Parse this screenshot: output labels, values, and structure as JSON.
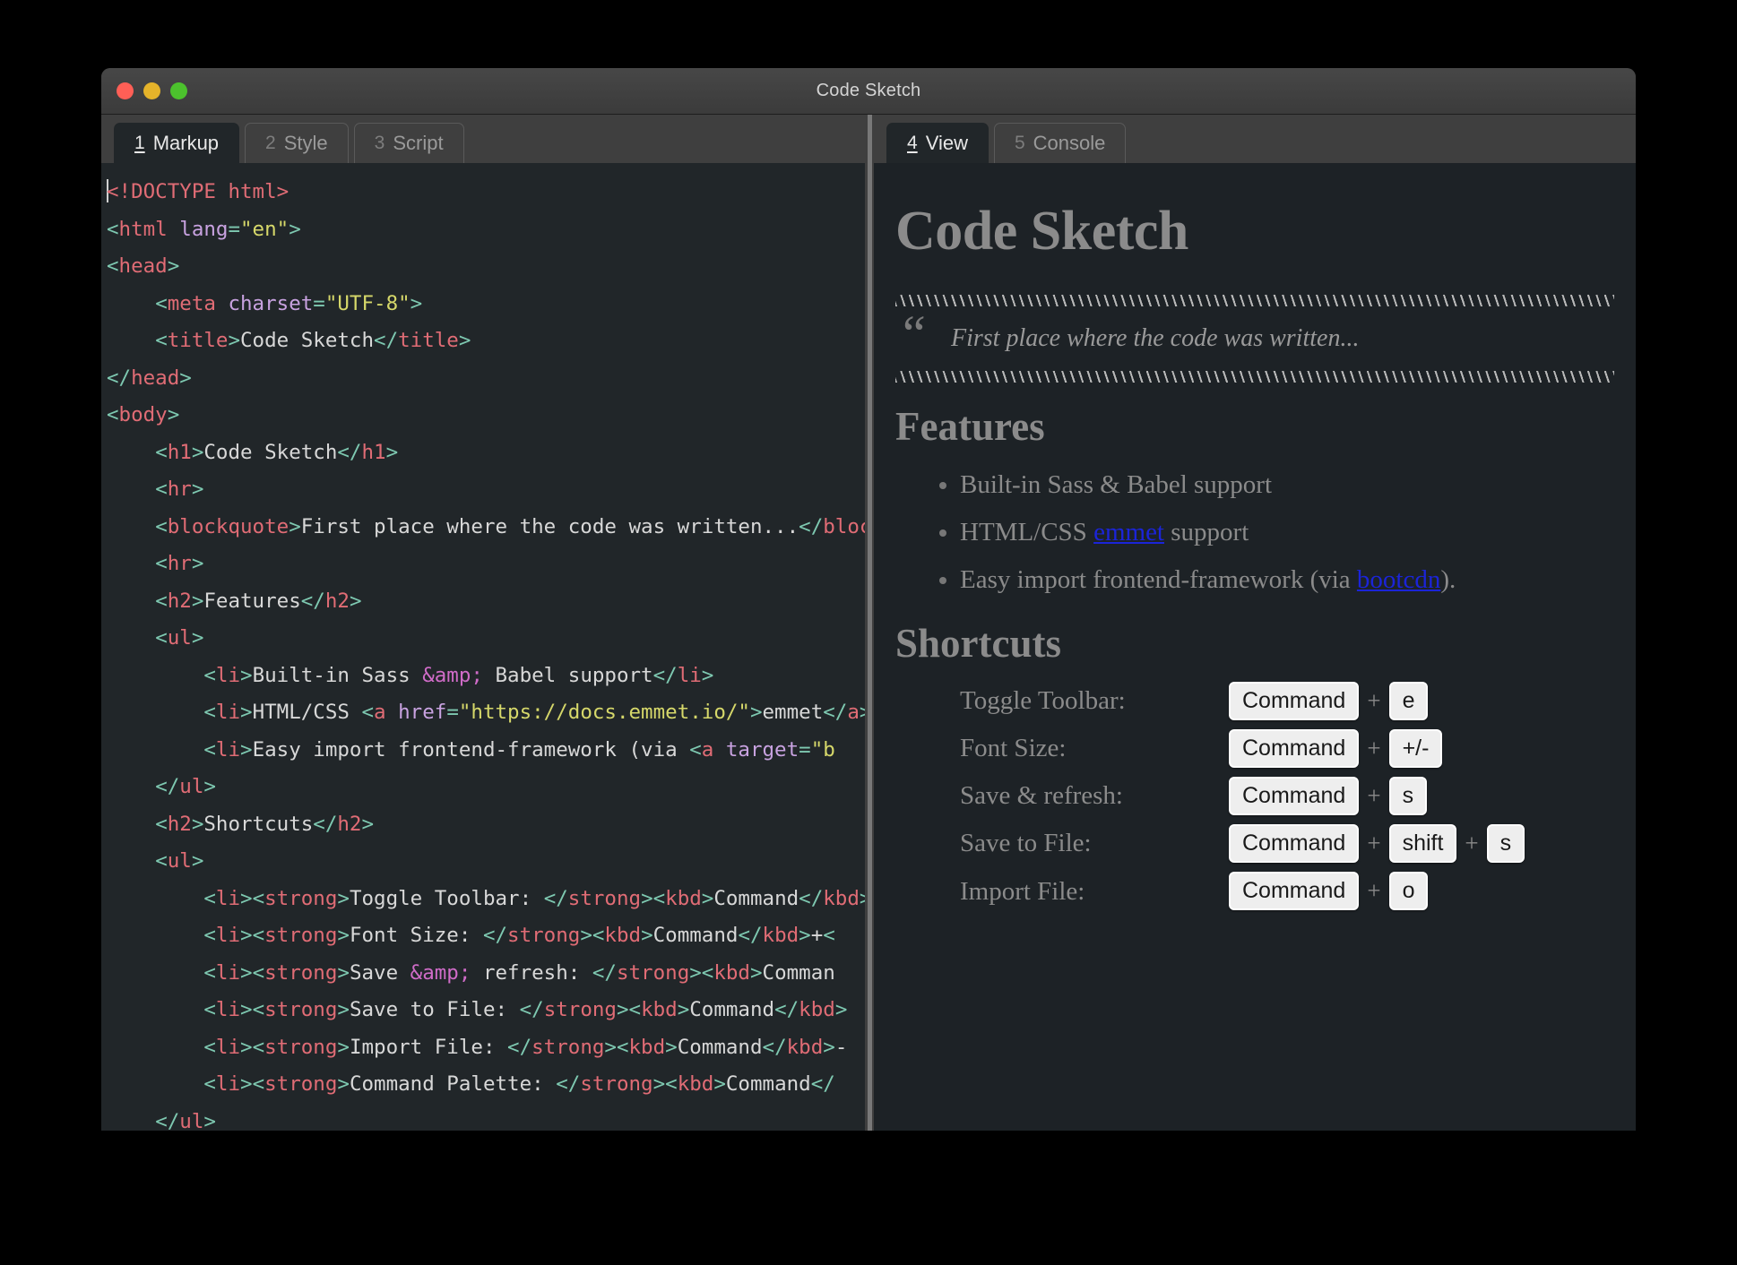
{
  "window": {
    "title": "Code Sketch",
    "traffic_lights": [
      {
        "name": "close",
        "color": "#ff5f56"
      },
      {
        "name": "minimize",
        "color": "#e5b32a"
      },
      {
        "name": "zoom",
        "color": "#4cc22d"
      }
    ]
  },
  "left_pane": {
    "tabs": [
      {
        "num": "1",
        "label": "Markup",
        "active": true
      },
      {
        "num": "2",
        "label": "Style",
        "active": false
      },
      {
        "num": "3",
        "label": "Script",
        "active": false
      }
    ]
  },
  "right_pane": {
    "tabs": [
      {
        "num": "4",
        "label": "View",
        "active": true
      },
      {
        "num": "5",
        "label": "Console",
        "active": false
      }
    ]
  },
  "editor": {
    "language": "html",
    "lines": [
      "<!DOCTYPE html>",
      "<html lang=\"en\">",
      "<head>",
      "    <meta charset=\"UTF-8\">",
      "    <title>Code Sketch</title>",
      "</head>",
      "<body>",
      "    <h1>Code Sketch</h1>",
      "    <hr>",
      "    <blockquote>First place where the code was written...</blockquote>",
      "    <hr>",
      "    <h2>Features</h2>",
      "    <ul>",
      "        <li>Built-in Sass &amp; Babel support</li>",
      "        <li>HTML/CSS <a href=\"https://docs.emmet.io/\">emmet</a> support</li>",
      "        <li>Easy import frontend-framework (via <a target=\"b",
      "    </ul>",
      "    <h2>Shortcuts</h2>",
      "    <ul>",
      "        <li><strong>Toggle Toolbar: </strong><kbd>Command</kbd>",
      "        <li><strong>Font Size: </strong><kbd>Command</kbd>+<",
      "        <li><strong>Save &amp; refresh: </strong><kbd>Comman",
      "        <li><strong>Save to File: </strong><kbd>Command</kbd>",
      "        <li><strong>Import File: </strong><kbd>Command</kbd>-",
      "        <li><strong>Command Palette: </strong><kbd>Command</",
      "    </ul>"
    ]
  },
  "preview": {
    "h1": "Code Sketch",
    "blockquote": "First place where the code was written...",
    "quote_glyph": "“",
    "features_heading": "Features",
    "features": [
      {
        "before": "Built-in Sass & Babel support",
        "link": "",
        "after": ""
      },
      {
        "before": "HTML/CSS ",
        "link": "emmet",
        "after": " support"
      },
      {
        "before": "Easy import frontend-framework (via ",
        "link": "bootcdn",
        "after": ")."
      }
    ],
    "shortcuts_heading": "Shortcuts",
    "shortcuts": [
      {
        "label": "Toggle Toolbar:",
        "keys": [
          "Command",
          "e"
        ]
      },
      {
        "label": "Font Size:",
        "keys": [
          "Command",
          "+/-"
        ]
      },
      {
        "label": "Save & refresh:",
        "keys": [
          "Command",
          "s"
        ]
      },
      {
        "label": "Save to File:",
        "keys": [
          "Command",
          "shift",
          "s"
        ]
      },
      {
        "label": "Import File:",
        "keys": [
          "Command",
          "o"
        ]
      }
    ],
    "key_separator": "+",
    "link_color": "#1b24d8"
  }
}
